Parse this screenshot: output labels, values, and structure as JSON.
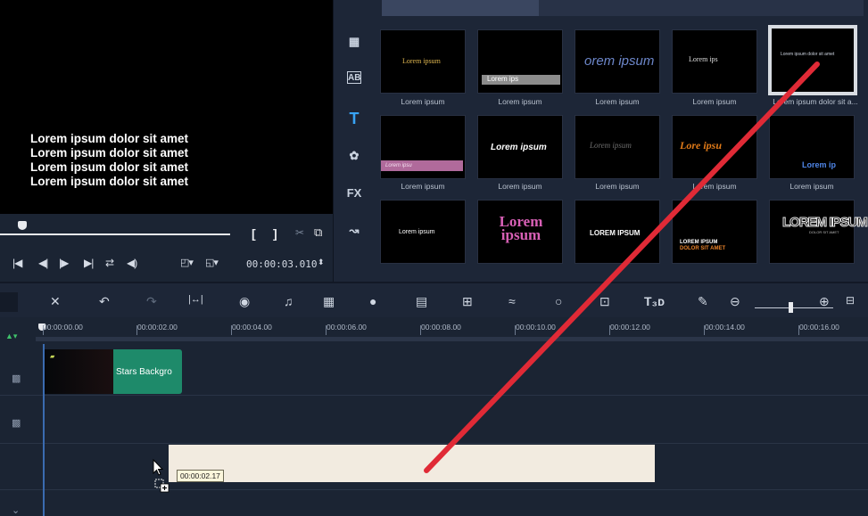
{
  "preview": {
    "lines": [
      "Lorem ipsum dolor sit amet",
      "Lorem ipsum dolor sit amet",
      "Lorem ipsum dolor sit amet",
      "Lorem ipsum dolor sit amet"
    ],
    "mark_in": "[",
    "mark_out": "]",
    "timecode": "00:00:03.010"
  },
  "transport": {
    "home": "|◀",
    "prev_frame": "◀|",
    "next_frame": "|▶",
    "end": "▶|",
    "repeat": "⇄",
    "volume": "◀)"
  },
  "library": {
    "side_icons": [
      "media-icon",
      "transition-icon",
      "title-icon",
      "graphics-icon",
      "fx-label",
      "path-icon"
    ],
    "side_active": "title-icon",
    "fx_label": "FX",
    "ab_label": "AB",
    "title_label": "T",
    "tiles": [
      {
        "caption": "Lorem ipsum",
        "text": "Lorem ipsum",
        "style": "gold-serif"
      },
      {
        "caption": "Lorem ipsum",
        "text": "Lorem ips",
        "style": "gray-bar"
      },
      {
        "caption": "Lorem ipsum",
        "text": "orem ipsum",
        "style": "blue-script"
      },
      {
        "caption": "Lorem ipsum",
        "text": "Lorem ips",
        "style": "white-serif"
      },
      {
        "caption": "Lorem ipsum dolor sit a...",
        "text": "Lorem ipsum dolor sit amet",
        "style": "small-lines"
      },
      {
        "caption": "Lorem ipsum",
        "text": "Lorem ipsu",
        "style": "pink-bar"
      },
      {
        "caption": "Lorem ipsum",
        "text": "Lorem ipsum",
        "style": "bold-italic"
      },
      {
        "caption": "Lorem ipsum",
        "text": "Lorem ipsum",
        "style": "gray-serif"
      },
      {
        "caption": "Lorem ipsum",
        "text": "Lore ipsu",
        "style": "orange-script"
      },
      {
        "caption": "Lorem ipsum",
        "text": "Lorem ip",
        "style": "blue-bold"
      },
      {
        "caption": "",
        "text": "Lorem ipsum",
        "style": "plain"
      },
      {
        "caption": "",
        "text": "Lorem ipsum",
        "style": "rainbow"
      },
      {
        "caption": "",
        "text": "LOREM IPSUM",
        "style": "caps"
      },
      {
        "caption": "",
        "text": "LOREM IPSUM",
        "subtext": "DOLOR SIT AMET",
        "style": "caps-orange"
      },
      {
        "caption": "",
        "text": "LOREM IPSUM",
        "subtext": "DOLOR SIT AMET",
        "style": "outline"
      }
    ]
  },
  "timeline": {
    "ruler": [
      "00:00:00.00",
      "00:00:02.00",
      "00:00:04.00",
      "00:00:06.00",
      "00:00:08.00",
      "00:00:10.00",
      "00:00:12.00",
      "00:00:14.00",
      "00:00:16.00"
    ],
    "clip_title": "Stars Backgro",
    "drop_tooltip": "00:00:02.17"
  },
  "colors": {
    "accent": "#38a4f5",
    "clip": "#1e8a6a",
    "annotation": "#e02a36"
  }
}
